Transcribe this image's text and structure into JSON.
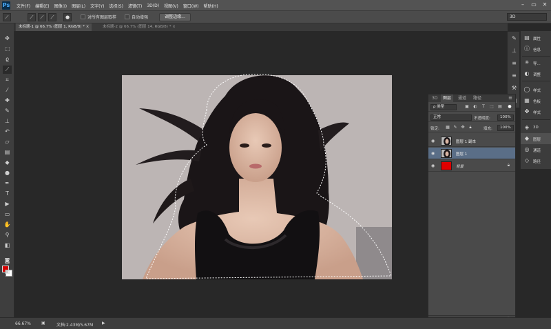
{
  "app": {
    "logo": "Ps"
  },
  "menu": [
    "文件(F)",
    "编辑(E)",
    "图像(I)",
    "图层(L)",
    "文字(Y)",
    "选择(S)",
    "滤镜(T)",
    "3D(D)",
    "视图(V)",
    "窗口(W)",
    "帮助(H)"
  ],
  "window_controls": {
    "minimize": "–",
    "restore": "▭",
    "close": "✕"
  },
  "options_bar": {
    "sample_all_layers": "对所有图层取样",
    "auto_enhance": "自动增强",
    "refine_edge": "调整边缘...",
    "workspace": "3D"
  },
  "tabs": [
    {
      "label": "未标题-1 @ 66.7% (图层 1, RGB/8) *"
    },
    {
      "label": "未标题-2 @ 66.7% (图层 14, RGB/8) *"
    }
  ],
  "colors": {
    "foreground": "#d40000",
    "background": "#ffffff",
    "accent": "#5a6e87"
  },
  "layers_panel": {
    "tabs": [
      "3D",
      "图层",
      "通道",
      "路径"
    ],
    "kind_filter": "ρ 类型",
    "blend_mode": "正常",
    "opacity_label": "不透明度:",
    "opacity_value": "100%",
    "lock_label": "锁定:",
    "fill_label": "填充:",
    "fill_value": "100%",
    "layers": [
      {
        "name": "图层 1 副本",
        "selected": false
      },
      {
        "name": "图层 1",
        "selected": true
      },
      {
        "name": "背景",
        "selected": false,
        "locked": true
      }
    ],
    "bottom_icons": [
      "link-icon",
      "fx-icon",
      "mask-icon",
      "adjustment-icon",
      "group-icon",
      "new-layer-icon",
      "trash-icon"
    ]
  },
  "right_dock": [
    {
      "icon": "properties-icon",
      "label": "属性"
    },
    {
      "icon": "info-icon",
      "label": "信息"
    },
    {
      "icon": "history-icon",
      "label": "导..."
    },
    {
      "icon": "adjustments-icon",
      "label": "调整"
    },
    {
      "icon": "paths-icon",
      "label": "样式"
    },
    {
      "icon": "channels-icon",
      "label": "色板"
    },
    {
      "icon": "styles-icon",
      "label": "样式"
    },
    {
      "icon": "3d-icon",
      "label": "3D"
    },
    {
      "icon": "layers-icon",
      "label": "图层"
    },
    {
      "icon": "channels-icon",
      "label": "通道"
    },
    {
      "icon": "paths-icon",
      "label": "路径"
    }
  ],
  "status": {
    "zoom": "66.67%",
    "doc": "文档:2.43M/5.67M"
  }
}
